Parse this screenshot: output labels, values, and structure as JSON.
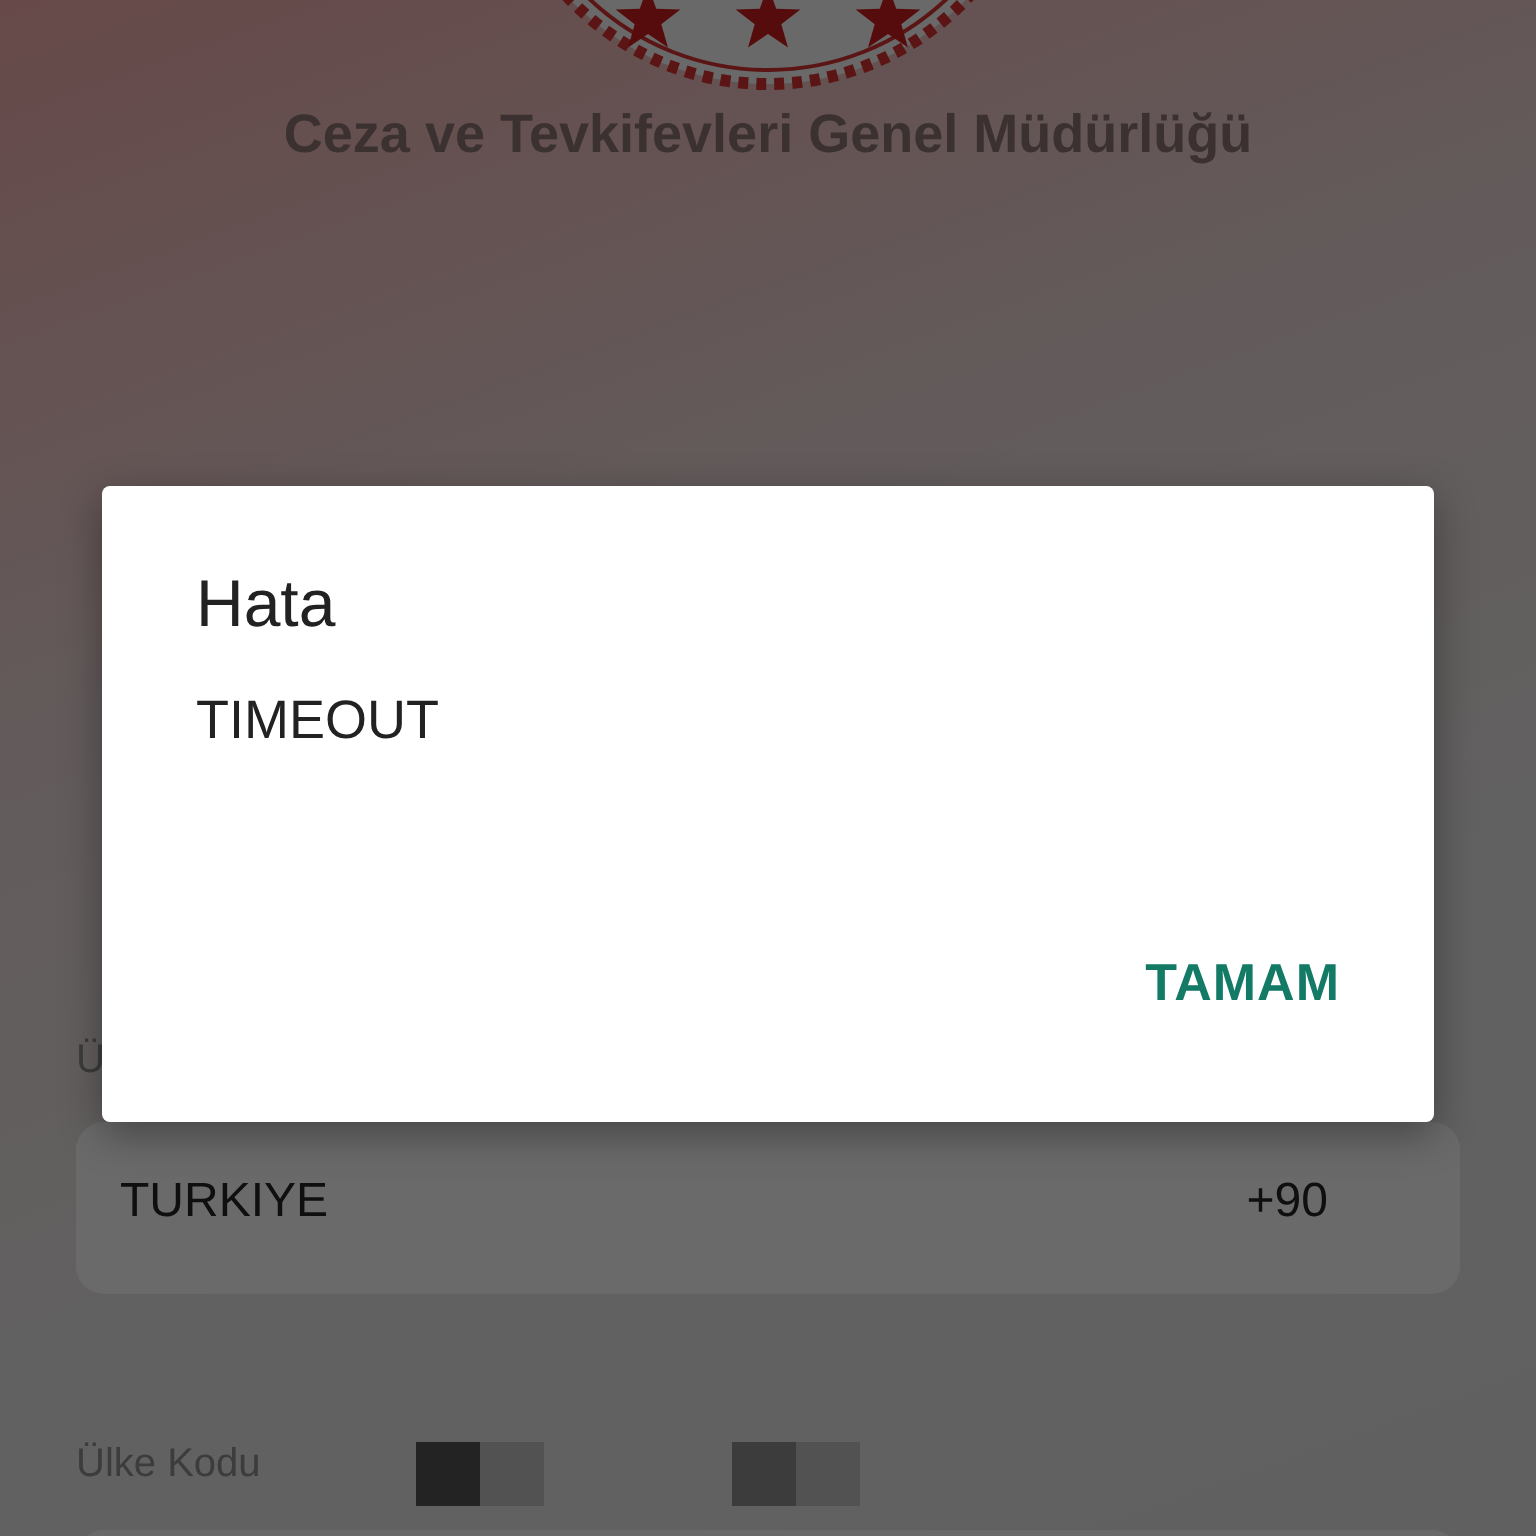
{
  "header": {
    "title": "Ceza ve Tevkifevleri Genel Müdürlüğü"
  },
  "fields": [
    {
      "label": "Ü",
      "value": "TURKIYE",
      "code": "+90"
    },
    {
      "label": "Ülke Kodu"
    }
  ],
  "dialog": {
    "title": "Hata",
    "message": "TIMEOUT",
    "buttons": [
      {
        "label": "TAMAM"
      }
    ]
  }
}
